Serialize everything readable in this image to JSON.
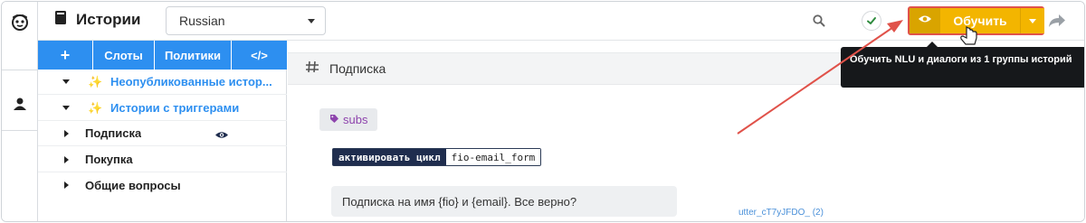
{
  "header": {
    "title": "Истории",
    "language": "Russian",
    "train_label": "Обучить"
  },
  "tooltip": {
    "text": "Обучить NLU и диалоги из 1 группы историй"
  },
  "sidebar": {
    "tabs": [
      {
        "label": "+"
      },
      {
        "label": "Слоты"
      },
      {
        "label": "Политики"
      },
      {
        "label": "</>"
      }
    ],
    "items": [
      {
        "label": "Неопубликованные истор...",
        "special": true,
        "expanded": true
      },
      {
        "label": "Истории с триггерами",
        "special": true,
        "expanded": true
      },
      {
        "label": "Подписка",
        "special": false,
        "expanded": false,
        "active": true
      },
      {
        "label": "Покупка",
        "special": false,
        "expanded": false
      },
      {
        "label": "Общие вопросы",
        "special": false,
        "expanded": false
      }
    ]
  },
  "main": {
    "story_title": "Подписка",
    "intent_tag": "subs",
    "form_action_label": "активировать цикл",
    "form_name": "fio-email_form",
    "bot_message": "Подписка на имя {fio} и {email}. Все верно?",
    "utter_ref": "utter_cT7yJFDO_  (2)"
  },
  "colors": {
    "accent_blue": "#2d8ff0",
    "train_yellow": "#f3b500",
    "annotation_red": "#e0524a",
    "intent_purple": "#8e44ad"
  }
}
